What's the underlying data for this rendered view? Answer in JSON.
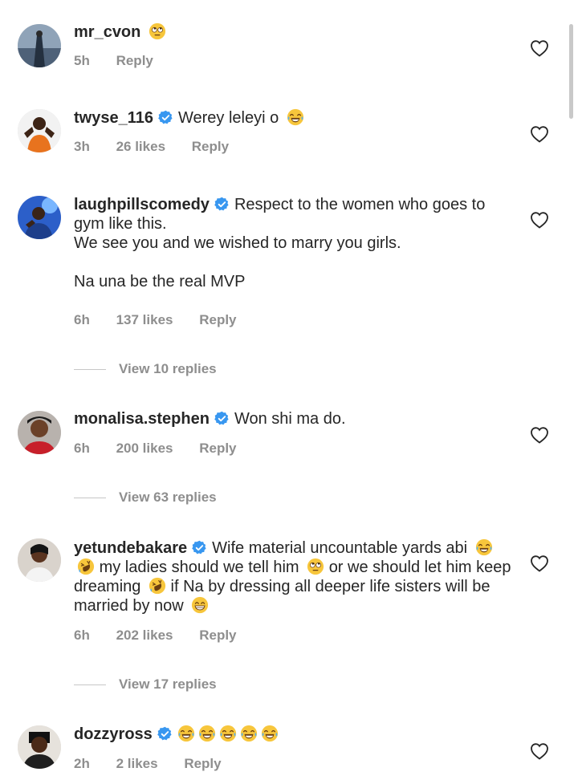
{
  "comments": [
    {
      "username": "mr_cvon",
      "verified": false,
      "text": "",
      "emoji": [
        "rolling-eyes"
      ],
      "time": "5h",
      "likes": "",
      "reply": "Reply"
    },
    {
      "username": "twyse_116",
      "verified": true,
      "text": "Werey leleyi o",
      "emoji": [
        "tears-of-joy"
      ],
      "time": "3h",
      "likes": "26 likes",
      "reply": "Reply"
    },
    {
      "username": "laughpillscomedy",
      "verified": true,
      "text": "Respect to the women who goes to gym like this.\nWe see you and we wished to marry you girls.\n\nNa una be the real MVP",
      "time": "6h",
      "likes": "137 likes",
      "reply": "Reply",
      "view_replies": "View 10 replies"
    },
    {
      "username": "monalisa.stephen",
      "verified": true,
      "text": "Won shi ma do.",
      "time": "6h",
      "likes": "200 likes",
      "reply": "Reply",
      "view_replies": "View 63 replies"
    },
    {
      "username": "yetundebakare",
      "verified": true,
      "text_parts": [
        "Wife material uncountable yards abi",
        "my ladies should we tell him",
        "or we should let him keep dreaming",
        "if Na by dressing all deeper life sisters will be married by now"
      ],
      "time": "6h",
      "likes": "202 likes",
      "reply": "Reply",
      "view_replies": "View 17 replies"
    },
    {
      "username": "dozzyross",
      "verified": true,
      "text": "",
      "emoji": [
        "tears-of-joy",
        "tears-of-joy",
        "tears-of-joy",
        "tears-of-joy",
        "tears-of-joy"
      ],
      "time": "2h",
      "likes": "2 likes",
      "reply": "Reply"
    }
  ],
  "colors": {
    "text": "#262626",
    "meta": "#8e8e8e",
    "verified": "#3897f0",
    "emoji": "#f7c63c"
  },
  "icons": {
    "like": "heart-outline-icon",
    "verified": "verified-badge-icon"
  }
}
